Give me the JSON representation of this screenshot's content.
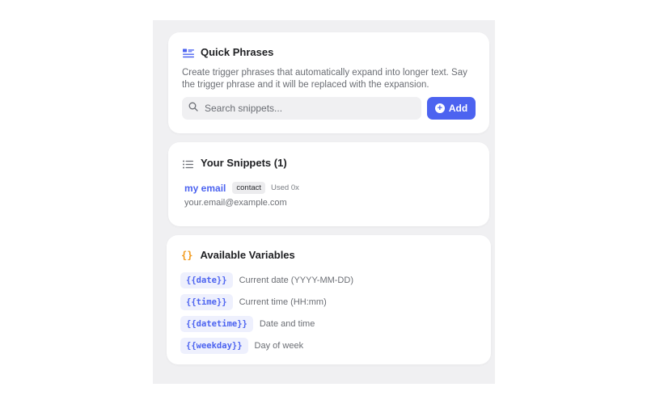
{
  "colors": {
    "accent": "#4c63f0",
    "variable_icon": "#f29b1d",
    "panel_bg": "#f0f0f2"
  },
  "quick_phrases": {
    "icon": "text-lines-icon",
    "title": "Quick Phrases",
    "description": "Create trigger phrases that automatically expand into longer text. Say the trigger phrase and it will be replaced with the expansion.",
    "search": {
      "icon": "search-icon",
      "placeholder": "Search snippets...",
      "value": ""
    },
    "add_button": {
      "icon": "plus-circle-icon",
      "label": "Add"
    }
  },
  "snippets": {
    "icon": "list-icon",
    "title": "Your Snippets (1)",
    "items": [
      {
        "trigger": "my email",
        "category": "contact",
        "usage": "Used 0x",
        "expansion": "your.email@example.com"
      }
    ]
  },
  "variables": {
    "icon": "braces-icon",
    "icon_glyph": "{}",
    "title": "Available Variables",
    "items": [
      {
        "token": "{{date}}",
        "description": "Current date (YYYY-MM-DD)"
      },
      {
        "token": "{{time}}",
        "description": "Current time (HH:mm)"
      },
      {
        "token": "{{datetime}}",
        "description": "Date and time"
      },
      {
        "token": "{{weekday}}",
        "description": "Day of week"
      }
    ]
  }
}
